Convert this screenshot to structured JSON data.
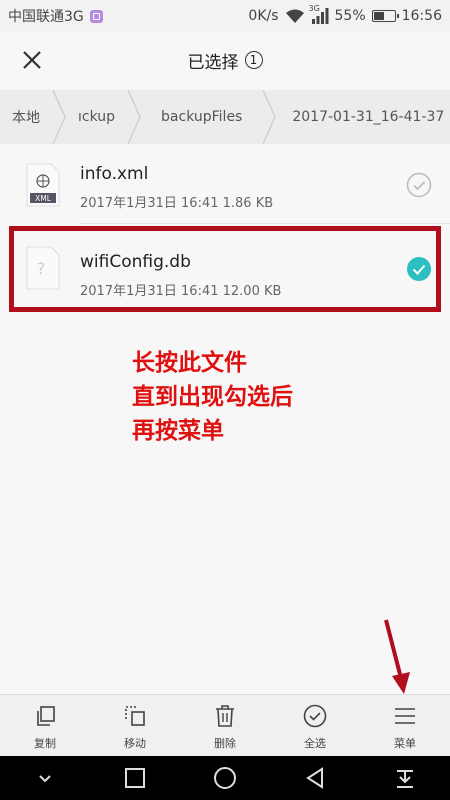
{
  "status_bar": {
    "carrier": "中国联通3G",
    "speed": "0K/s",
    "network_badge": "3G",
    "battery_percent": "55%",
    "battery_level": 0.55,
    "time": "16:56"
  },
  "header": {
    "title": "已选择",
    "selected_count": "1",
    "close_icon": "close-icon"
  },
  "breadcrumb": [
    "本地",
    "ıckup",
    "backupFiles",
    "2017-01-31_16-41-37"
  ],
  "files": [
    {
      "name": "info.xml",
      "meta": "2017年1月31日 16:41 1.86 KB",
      "icon": "xml-file-icon",
      "icon_label": "XML",
      "selected": false
    },
    {
      "name": "wifiConfig.db",
      "meta": "2017年1月31日 16:41 12.00 KB",
      "icon": "unknown-file-icon",
      "icon_label": "?",
      "selected": true
    }
  ],
  "annotation": {
    "lines": [
      "长按此文件",
      "直到出现勾选后",
      "再按菜单"
    ],
    "color": "#e01010",
    "box_color": "#b00d1d"
  },
  "toolbar": [
    {
      "label": "复制",
      "icon": "copy-icon"
    },
    {
      "label": "移动",
      "icon": "move-icon"
    },
    {
      "label": "删除",
      "icon": "delete-icon"
    },
    {
      "label": "全选",
      "icon": "select-all-icon"
    },
    {
      "label": "菜单",
      "icon": "menu-icon"
    }
  ],
  "colors": {
    "accent_teal": "#2bbfbf"
  }
}
